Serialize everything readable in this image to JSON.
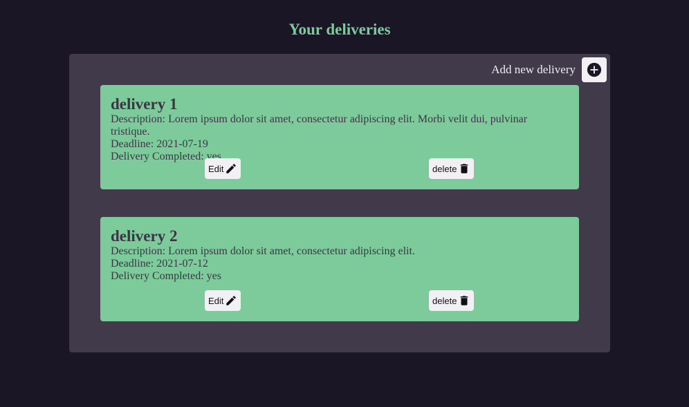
{
  "page": {
    "title": "Your deliveries"
  },
  "toolbar": {
    "add_label": "Add new delivery",
    "add_icon": "plus-circle-icon"
  },
  "deliveries": [
    {
      "name": "delivery 1",
      "description": "Description: Lorem ipsum dolor sit amet, consectetur adipiscing elit. Morbi velit dui, pulvinar tristique.",
      "deadline": "Deadline: 2021-07-19",
      "completed": "Delivery Completed: yes",
      "edit_label": "Edit",
      "delete_label": "delete"
    },
    {
      "name": "delivery 2",
      "description": "Description: Lorem ipsum dolor sit amet, consectetur adipiscing elit.",
      "deadline": "Deadline: 2021-07-12",
      "completed": "Delivery Completed: yes",
      "edit_label": "Edit",
      "delete_label": "delete"
    }
  ],
  "colors": {
    "background": "#1b1626",
    "panel": "#413a4a",
    "card": "#7dcb9b",
    "accent_title": "#7dcb9b",
    "button_bg": "#f2f0f4"
  }
}
